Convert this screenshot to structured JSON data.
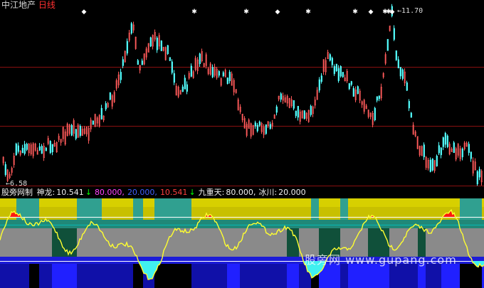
{
  "header": {
    "stock_name": "中江地产",
    "period": "日线",
    "colors": {
      "stock_name": "#d8d8d8",
      "period": "#ff3030"
    }
  },
  "price_chart": {
    "high_label": "11.70",
    "low_label": "6.58",
    "y_range": [
      6.3,
      11.9
    ]
  },
  "indicator": {
    "name": "股旁网制",
    "legend": [
      {
        "label": "神龙:",
        "value": "10.541",
        "arrow": "↓",
        "color": "#f0f0f0",
        "arrow_color": "#00ff00"
      },
      {
        "label": "",
        "value": "80.000,",
        "arrow": "",
        "color": "#ff44ff",
        "arrow_color": ""
      },
      {
        "label": "",
        "value": "20.000,",
        "arrow": "",
        "color": "#4060ff",
        "arrow_color": ""
      },
      {
        "label": "",
        "value": "10.541",
        "arrow": "↓",
        "color": "#ff4040",
        "arrow_color": "#00ff00"
      },
      {
        "label": "九重天:",
        "value": "80.000,",
        "arrow": "",
        "color": "#f0f0f0",
        "arrow_color": ""
      },
      {
        "label": "冰川:",
        "value": "20.000",
        "arrow": "",
        "color": "#f0f0f0",
        "arrow_color": ""
      }
    ],
    "name_color": "#f0f0f0"
  },
  "watermark": "股旁网 www.gupang.com"
}
